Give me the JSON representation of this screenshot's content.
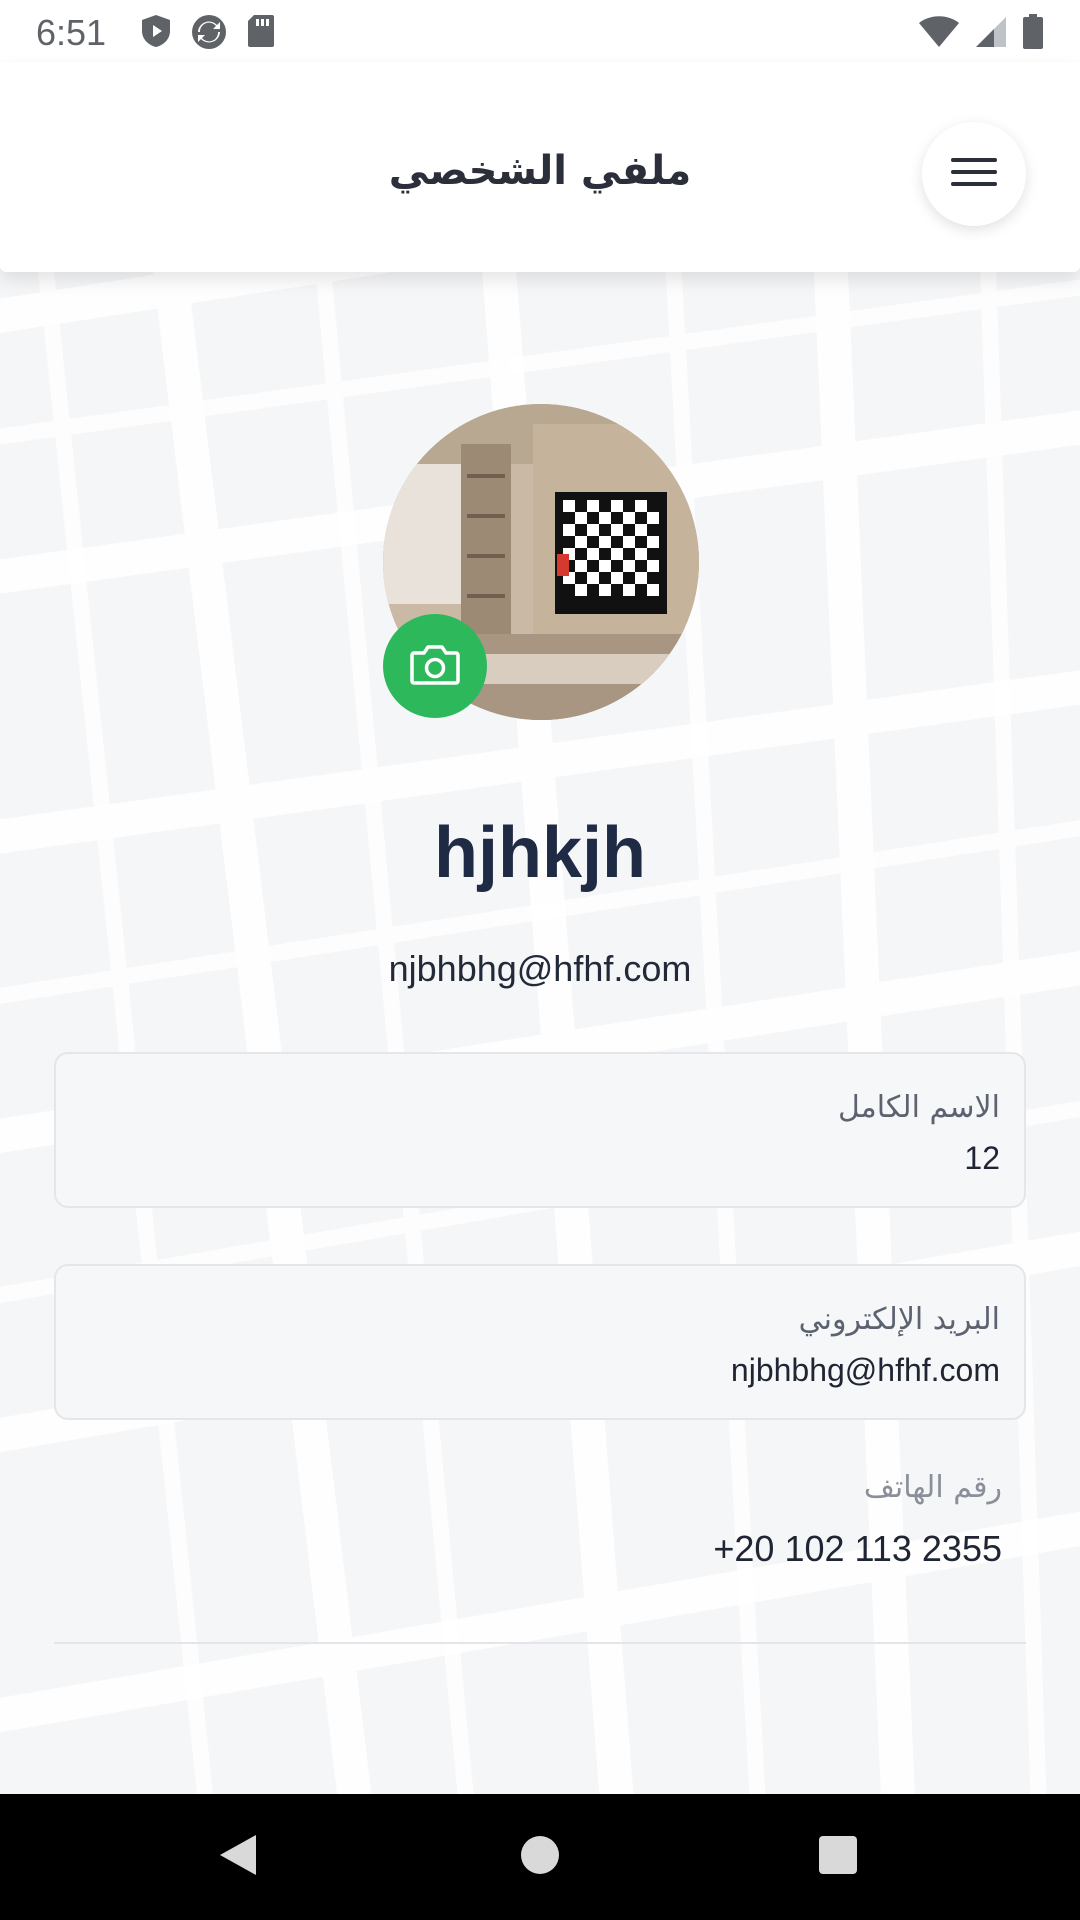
{
  "status_bar": {
    "time": "6:51",
    "left_icons": [
      "shield-play-icon",
      "sync-icon",
      "sd-card-icon"
    ],
    "right_icons": [
      "wifi-icon",
      "cell-signal-icon",
      "battery-icon"
    ]
  },
  "header": {
    "title": "ملفي الشخصي",
    "menu_icon": "hamburger-menu-icon"
  },
  "profile": {
    "avatar_alt": "profile photo",
    "camera_icon": "camera-icon",
    "name": "hjhkjh",
    "email": "njbhbhg@hfhf.com"
  },
  "fields": {
    "full_name": {
      "label": "الاسم الكامل",
      "value": "12"
    },
    "email": {
      "label": "البريد الإلكتروني",
      "value": "njbhbhg@hfhf.com"
    },
    "phone": {
      "label": "رقم الهاتف",
      "value": "+20 102 113 2355"
    }
  },
  "nav_bar": {
    "back_icon": "back-triangle-icon",
    "home_icon": "home-circle-icon",
    "recents_icon": "recents-square-icon"
  },
  "colors": {
    "accent_green": "#2eb85c",
    "title_dark": "#1f2a44",
    "background": "#f5f6f8"
  }
}
